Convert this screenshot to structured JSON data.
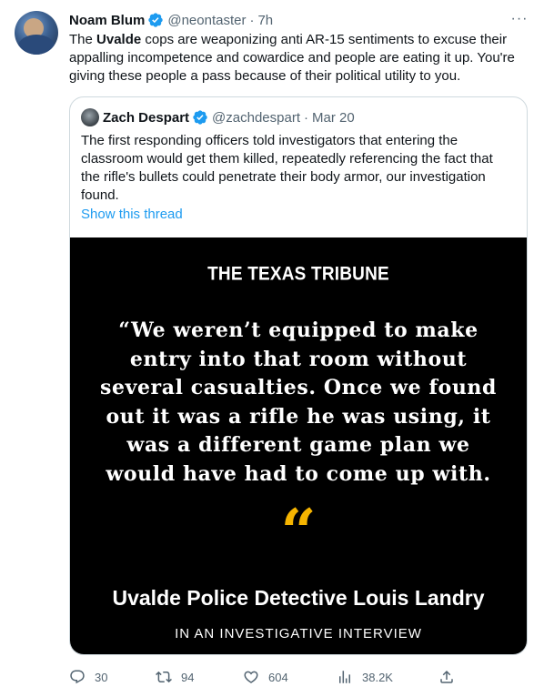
{
  "tweet": {
    "author_name": "Noam Blum",
    "author_handle": "@neontaster",
    "time": "7h",
    "text_before": "The ",
    "text_bold": "Uvalde",
    "text_after": " cops are weaponizing anti AR-15 sentiments to excuse their appalling incompetence and cowardice and people are eating it up. You're giving these people a pass because of their political utility to you."
  },
  "quoted": {
    "author_name": "Zach Despart",
    "author_handle": "@zachdespart",
    "date": "Mar 20",
    "text": "The first responding officers told investigators that entering the classroom would get them killed, repeatedly referencing the fact that the rifle's bullets could penetrate their body armor, our investigation found.",
    "show_thread": "Show this thread"
  },
  "card": {
    "masthead": "THE TEXAS TRIBUNE",
    "quote_lines": [
      "“We weren’t equipped to make",
      "entry into that room without",
      "several casualties. Once we found",
      "out it was a rifle he was using, it",
      "was a different game plan we",
      "would have had to come up with."
    ],
    "quote_mark": "“",
    "attribution": "Uvalde Police Detective Louis Landry",
    "attribution_sub": "IN AN INVESTIGATIVE INTERVIEW"
  },
  "actions": {
    "replies": "30",
    "retweets": "94",
    "likes": "604",
    "views": "38.2K"
  },
  "colors": {
    "verified": "#1d9bf0",
    "link": "#1d9bf0",
    "quote_mark": "#f5b400",
    "muted": "#536471"
  },
  "icons": [
    "more-icon",
    "verified-icon",
    "reply-icon",
    "retweet-icon",
    "like-icon",
    "views-icon",
    "share-icon"
  ]
}
